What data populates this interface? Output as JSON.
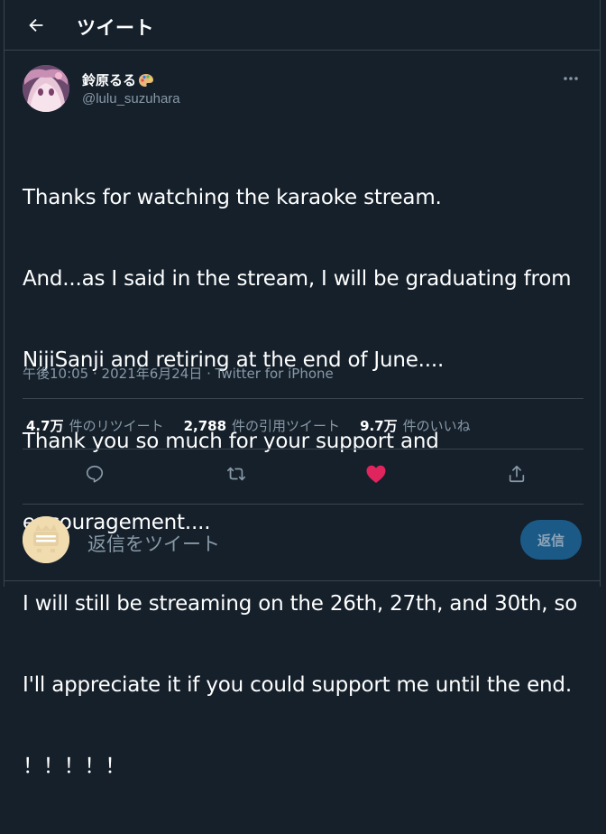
{
  "header": {
    "title": "ツイート",
    "back_icon": "arrow-left-icon"
  },
  "author": {
    "display_name": "鈴原るる",
    "name_emoji": "palette-icon",
    "handle": "@lulu_suzuhara"
  },
  "tweet": {
    "lines": [
      "Thanks for watching the karaoke stream.",
      "And...as I said in the stream, I will be graduating from",
      "NijiSanji and retiring at the end of June....",
      "Thank you so much for your support and",
      "encouragement....",
      "I will still be streaming on the 26th, 27th, and 30th, so",
      "I'll appreciate it if you could support me until the end.",
      "！！！！！"
    ],
    "time": "午後10:05",
    "separator": " · ",
    "date": "2021年6月24日",
    "source": "Twitter for iPhone"
  },
  "stats": {
    "retweets_count": "4.7万",
    "retweets_label": "件のリツイート",
    "quotes_count": "2,788",
    "quotes_label": "件の引用ツイート",
    "likes_count": "9.7万",
    "likes_label": "件のいいね"
  },
  "actions": {
    "reply_icon": "speech-bubble-icon",
    "retweet_icon": "retweet-icon",
    "like_icon": "heart-icon",
    "share_icon": "share-icon"
  },
  "reply": {
    "placeholder": "返信をツイート",
    "button_label": "返信"
  },
  "colors": {
    "background": "#15202b",
    "border": "#38444d",
    "secondary_text": "#8899a6",
    "like_active": "#e0245e",
    "button_bg": "#1b5a87"
  }
}
